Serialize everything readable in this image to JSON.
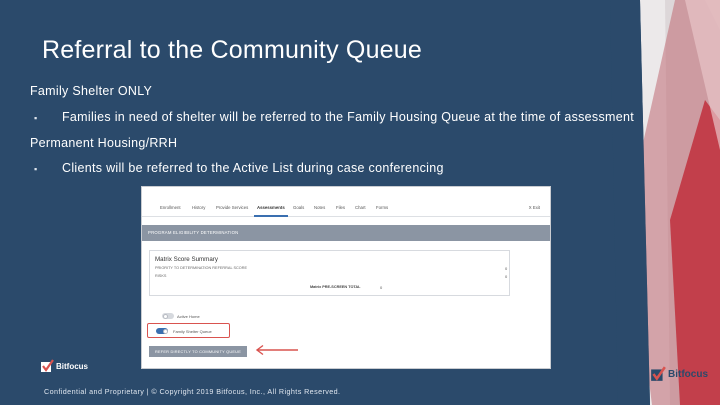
{
  "slide": {
    "title": "Referral to the Community Queue",
    "sections": [
      {
        "heading": "Family Shelter ONLY",
        "bullet": "Families in need of shelter  will be referred to the Family Housing Queue at the time of assessment"
      },
      {
        "heading": "Permanent Housing/RRH",
        "bullet": "Clients will be referred to the Active List during case conferencing"
      }
    ],
    "bullet_glyph": "▪",
    "footer": "Confidential and Proprietary | © Copyright 2019 Bitfocus, Inc., All Rights Reserved."
  },
  "logos": {
    "bitfocus_left": "Bitfocus",
    "bitfocus_right": "Bitfocus"
  },
  "screenshot": {
    "tabs": [
      "Enrollment",
      "History",
      "Provide Services",
      "Assessments",
      "Goals",
      "Notes",
      "Files",
      "Chart",
      "Forms"
    ],
    "active_tab": "Assessments",
    "close_label": "X Exit",
    "band_title": "PROGRAM ELIGIBILITY DETERMINATION",
    "card_title": "Matrix Score Summary",
    "lines": [
      {
        "label": "PRIORITY TO DETERMINATION REFERRAL SCORE",
        "value": "0"
      },
      {
        "label": "RISKS",
        "value": "0"
      }
    ],
    "total_label": "Matrix PRE-SCREEN TOTAL",
    "total_value": "0",
    "toggle_active_list": "Active Home",
    "toggle_family_queue": "Family Shelter Queue",
    "refer_button": "REFER DIRECTLY TO COMMUNITY QUEUE"
  },
  "colors": {
    "background": "#2b4a6b",
    "accent_red": "#d9534f",
    "brand_blue": "#3a6fb0"
  }
}
